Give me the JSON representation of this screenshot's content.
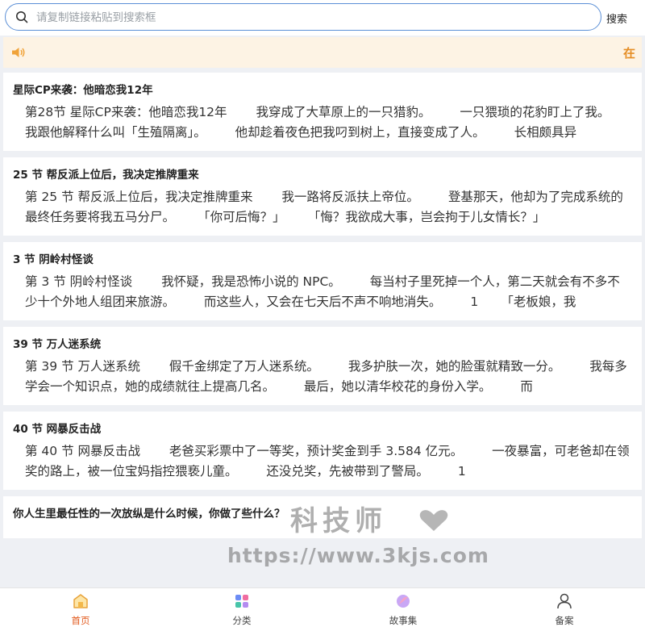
{
  "search": {
    "placeholder": "请复制链接粘贴到搜索框",
    "button_label": "搜索"
  },
  "notice": {
    "text": "在"
  },
  "stories": [
    {
      "title": "星际CP来袭：他暗恋我12年",
      "excerpt": "第28节 星际CP来袭：他暗恋我12年 　　我穿成了大草原上的一只猎豹。 　　一只猥琐的花豹盯上了我。 　　我跟他解释什么叫「生殖隔离」。 　　他却趁着夜色把我叼到树上，直接变成了人。 　　长相颇具异"
    },
    {
      "title": "25 节 帮反派上位后，我决定推牌重来",
      "excerpt": "第 25 节 帮反派上位后，我决定推牌重来 　　我一路将反派扶上帝位。 　　登基那天，他却为了完成系统的最终任务要将我五马分尸。 　　「你可后悔？」 　　「悔？我欲成大事，岂会拘于儿女情长？」"
    },
    {
      "title": "3 节 阴岭村怪谈",
      "excerpt": "第 3 节 阴岭村怪谈 　　我怀疑，我是恐怖小说的 NPC。 　　每当村子里死掉一个人，第二天就会有不多不少十个外地人组团来旅游。 　　而这些人，又会在七天后不声不响地消失。 　　1 　　「老板娘，我"
    },
    {
      "title": "39 节 万人迷系统",
      "excerpt": "第 39 节 万人迷系统 　　假千金绑定了万人迷系统。 　　我多护肤一次，她的脸蛋就精致一分。 　　我每多学会一个知识点，她的成绩就往上提高几名。 　　最后，她以清华校花的身份入学。 　　而"
    },
    {
      "title": "40 节 网暴反击战",
      "excerpt": "第 40 节 网暴反击战 　　老爸买彩票中了一等奖，预计奖金到手 3.584 亿元。 　　一夜暴富，可老爸却在领奖的路上，被一位宝妈指控猥亵儿童。 　　还没兑奖，先被带到了警局。 　　1"
    },
    {
      "title": "你人生里最任性的一次放纵是什么时候，你做了些什么？",
      "excerpt": ""
    }
  ],
  "nav": {
    "items": [
      {
        "label": "首页",
        "icon": "home-icon"
      },
      {
        "label": "分类",
        "icon": "category-icon"
      },
      {
        "label": "故事集",
        "icon": "story-collection-icon"
      },
      {
        "label": "备案",
        "icon": "profile-icon"
      }
    ]
  },
  "watermark": {
    "cn": "科技师",
    "url": "https://www.3kjs.com"
  },
  "colors": {
    "accent": "#e25b1f",
    "search_border": "#5b8fd6",
    "notice_bg": "#fdf3e4",
    "notice_text": "#e58e26"
  }
}
